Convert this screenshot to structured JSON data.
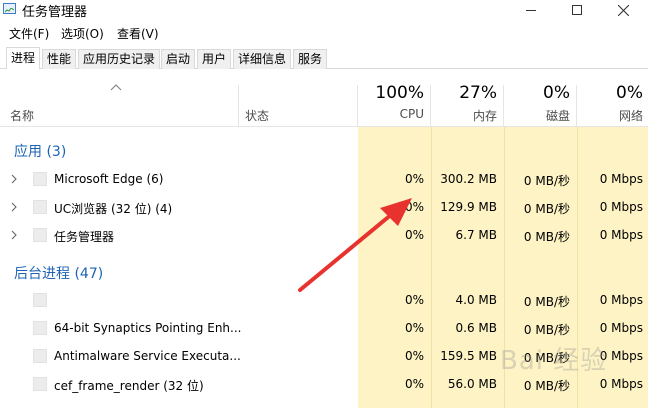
{
  "window": {
    "title": "任务管理器"
  },
  "menu": {
    "file": "文件(F)",
    "options": "选项(O)",
    "view": "查看(V)"
  },
  "tabs": [
    "进程",
    "性能",
    "应用历史记录",
    "启动",
    "用户",
    "详细信息",
    "服务"
  ],
  "columns": {
    "name": "名称",
    "status": "状态",
    "cpu": {
      "pct": "100%",
      "label": "CPU"
    },
    "memory": {
      "pct": "27%",
      "label": "内存"
    },
    "disk": {
      "pct": "0%",
      "label": "磁盘"
    },
    "network": {
      "pct": "0%",
      "label": "网络"
    }
  },
  "groups": {
    "apps": "应用 (3)",
    "background": "后台进程 (47)"
  },
  "apps": [
    {
      "name": "Microsoft Edge (6)",
      "cpu": "0%",
      "mem": "300.2 MB",
      "disk": "0 MB/秒",
      "net": "0 Mbps"
    },
    {
      "name": "UC浏览器 (32 位) (4)",
      "cpu": "0%",
      "mem": "129.9 MB",
      "disk": "0 MB/秒",
      "net": "0 Mbps"
    },
    {
      "name": "任务管理器",
      "cpu": "0%",
      "mem": "6.7 MB",
      "disk": "0 MB/秒",
      "net": "0 Mbps"
    }
  ],
  "background": [
    {
      "name": "",
      "cpu": "0%",
      "mem": "4.0 MB",
      "disk": "0 MB/秒",
      "net": "0 Mbps"
    },
    {
      "name": "64-bit Synaptics Pointing Enh...",
      "cpu": "0%",
      "mem": "0.6 MB",
      "disk": "0 MB/秒",
      "net": "0 Mbps"
    },
    {
      "name": "Antimalware Service Executa...",
      "cpu": "0%",
      "mem": "159.5 MB",
      "disk": "0 MB/秒",
      "net": "0 Mbps"
    },
    {
      "name": "cef_frame_render (32 位)",
      "cpu": "0%",
      "mem": "56.0 MB",
      "disk": "0 MB/秒",
      "net": "0 Mbps"
    }
  ],
  "colors": {
    "accent": "#1e64b4",
    "shade": "#fdf3c4",
    "arrow": "#e8322e"
  },
  "watermark": "Bai 经验"
}
